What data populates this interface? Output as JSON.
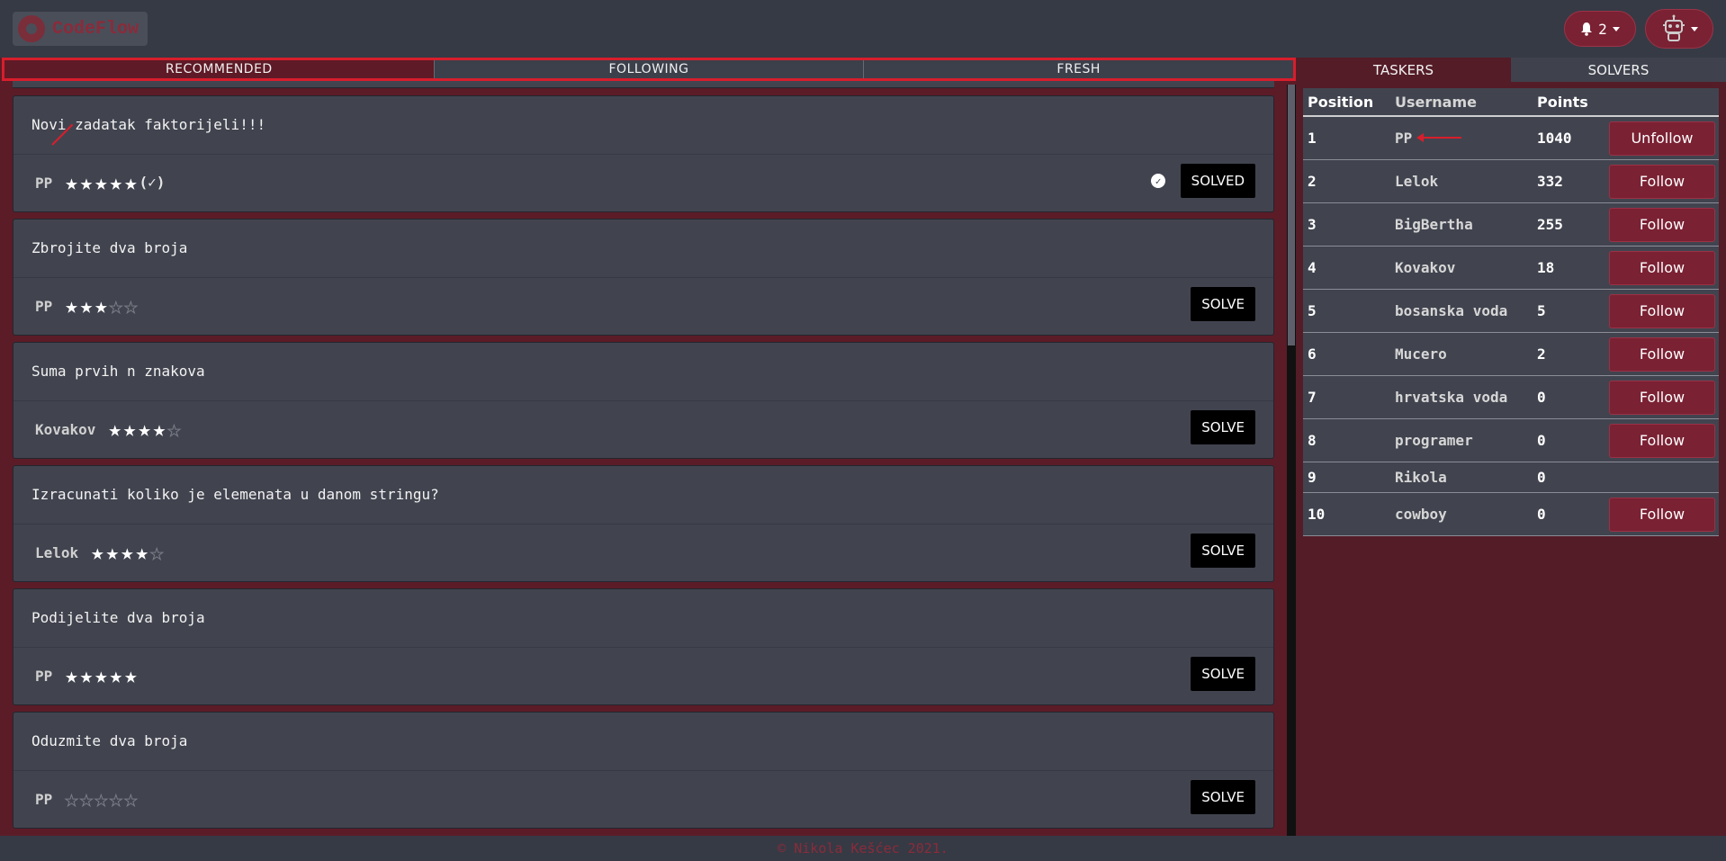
{
  "brand": {
    "name": "CodeFlow"
  },
  "navbar": {
    "notifications_count": "2"
  },
  "feed_tabs": [
    {
      "label": "RECOMMENDED",
      "active": true
    },
    {
      "label": "FOLLOWING",
      "active": false
    },
    {
      "label": "FRESH",
      "active": false
    }
  ],
  "tasks": [
    {
      "title": "Novi zadatak faktorijeli!!!",
      "author": "PP",
      "stars": 5,
      "verified": "(✓)",
      "button": "SOLVED",
      "solved": true
    },
    {
      "title": "Zbrojite dva broja",
      "author": "PP",
      "stars": 3,
      "button": "SOLVE",
      "solved": false
    },
    {
      "title": "Suma prvih n znakova",
      "author": "Kovakov",
      "stars": 4,
      "button": "SOLVE",
      "solved": false
    },
    {
      "title": "Izracunati koliko je elemenata u danom stringu?",
      "author": "Lelok",
      "stars": 4,
      "button": "SOLVE",
      "solved": false
    },
    {
      "title": "Podijelite dva broja",
      "author": "PP",
      "stars": 5,
      "button": "SOLVE",
      "solved": false
    },
    {
      "title": "Oduzmite dva broja",
      "author": "PP",
      "stars": 0,
      "button": "SOLVE",
      "solved": false
    }
  ],
  "leaderboard": {
    "tabs": [
      {
        "label": "TASKERS",
        "active": true
      },
      {
        "label": "SOLVERS",
        "active": false
      }
    ],
    "headers": {
      "position": "Position",
      "username": "Username",
      "points": "Points"
    },
    "rows": [
      {
        "position": "1",
        "username": "PP",
        "points": "1040",
        "action": "Unfollow"
      },
      {
        "position": "2",
        "username": "Lelok",
        "points": "332",
        "action": "Follow"
      },
      {
        "position": "3",
        "username": "BigBertha",
        "points": "255",
        "action": "Follow"
      },
      {
        "position": "4",
        "username": "Kovakov",
        "points": "18",
        "action": "Follow"
      },
      {
        "position": "5",
        "username": "bosanska voda",
        "points": "5",
        "action": "Follow"
      },
      {
        "position": "6",
        "username": "Mucero",
        "points": "2",
        "action": "Follow"
      },
      {
        "position": "7",
        "username": "hrvatska voda",
        "points": "0",
        "action": "Follow"
      },
      {
        "position": "8",
        "username": "programer",
        "points": "0",
        "action": "Follow"
      },
      {
        "position": "9",
        "username": "Rikola",
        "points": "0",
        "action": ""
      },
      {
        "position": "10",
        "username": "cowboy",
        "points": "0",
        "action": "Follow"
      }
    ]
  },
  "footer": {
    "text": "© Nikola Kešćec 2021."
  },
  "colors": {
    "accent": "#7a2133",
    "highlight": "#d81e2c",
    "card": "#41444f"
  }
}
